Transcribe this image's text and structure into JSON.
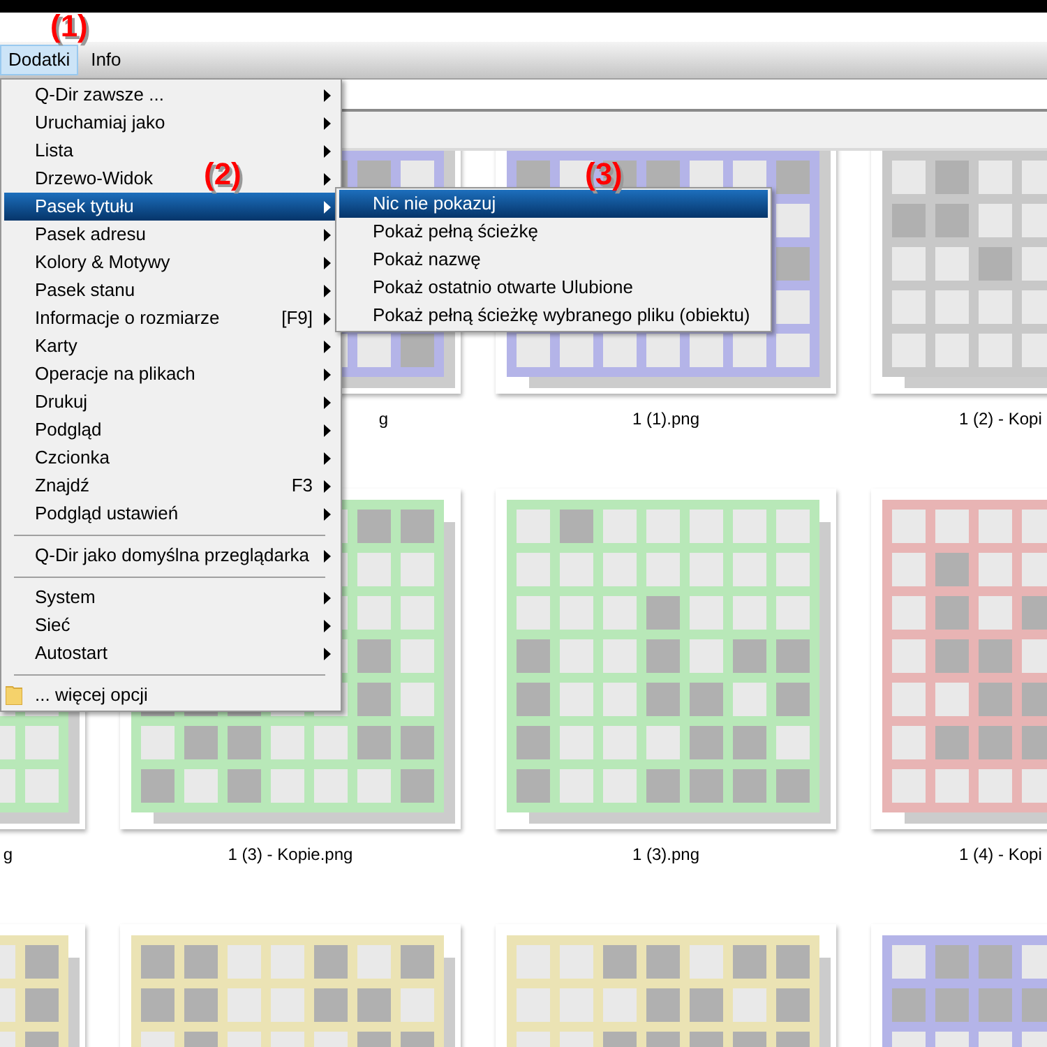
{
  "annotations": [
    {
      "label": "(1)"
    },
    {
      "label": "(2)"
    },
    {
      "label": "(3)"
    }
  ],
  "menu_bar": [
    {
      "label": "Dodatki",
      "selected": true
    },
    {
      "label": "Info",
      "selected": false
    }
  ],
  "menu": {
    "items": [
      {
        "kind": "item",
        "label": "Q-Dir zawsze ...",
        "selected": false
      },
      {
        "kind": "item",
        "label": "Uruchamiaj jako",
        "selected": false
      },
      {
        "kind": "item",
        "label": "Lista",
        "selected": false
      },
      {
        "kind": "item",
        "label": "Drzewo-Widok",
        "selected": false
      },
      {
        "kind": "item",
        "label": "Pasek tytułu",
        "selected": true
      },
      {
        "kind": "item",
        "label": "Pasek adresu",
        "selected": false
      },
      {
        "kind": "item",
        "label": "Kolory & Motywy",
        "selected": false
      },
      {
        "kind": "item",
        "label": "Pasek stanu",
        "selected": false
      },
      {
        "kind": "item",
        "label": "Informacje o rozmiarze",
        "shortcut": "[F9]",
        "selected": false
      },
      {
        "kind": "item",
        "label": "Karty",
        "selected": false
      },
      {
        "kind": "item",
        "label": "Operacje na plikach",
        "selected": false
      },
      {
        "kind": "item",
        "label": "Drukuj",
        "selected": false
      },
      {
        "kind": "item",
        "label": "Podgląd",
        "selected": false
      },
      {
        "kind": "item",
        "label": "Czcionka",
        "selected": false
      },
      {
        "kind": "item",
        "label": "Znajdź",
        "shortcut": "F3",
        "selected": false
      },
      {
        "kind": "item",
        "label": "Podgląd ustawień",
        "selected": false
      },
      {
        "kind": "separator"
      },
      {
        "kind": "item",
        "label": "Q-Dir jako domyślna przeglądarka",
        "selected": false
      },
      {
        "kind": "separator"
      },
      {
        "kind": "item",
        "label": "System",
        "selected": false
      },
      {
        "kind": "item",
        "label": "Sieć",
        "selected": false
      },
      {
        "kind": "item",
        "label": "Autostart",
        "selected": false
      },
      {
        "kind": "separator"
      },
      {
        "kind": "folder",
        "label": "... więcej opcji",
        "selected": false
      }
    ]
  },
  "submenu": {
    "items": [
      {
        "label": "Nic nie pokazuj",
        "selected": true
      },
      {
        "label": "Pokaż pełną ścieżkę",
        "selected": false
      },
      {
        "label": "Pokaż nazwę",
        "selected": false
      },
      {
        "label": "Pokaż ostatnio otwarte Ulubione",
        "selected": false
      },
      {
        "label": "Pokaż pełną ścieżkę wybranego pliku (obiektu)",
        "selected": false
      }
    ]
  },
  "files": [
    [
      {
        "kind": "cut_left",
        "color": "#b4b4e8",
        "label": "g"
      },
      {
        "kind": "tile",
        "color": "#b4b4e8",
        "label": "1 (1).png"
      },
      {
        "kind": "cut_right",
        "color": "#c8c8c8",
        "label": "1 (2) - Kopi"
      }
    ],
    [
      {
        "kind": "cut_left",
        "color": "#b8e8b8",
        "label": "g"
      },
      {
        "kind": "tile",
        "color": "#b8e8b8",
        "label": "1 (3) - Kopie.png"
      },
      {
        "kind": "tile",
        "color": "#b8e8b8",
        "label": "1 (3).png"
      },
      {
        "kind": "cut_right",
        "color": "#e8b4b4",
        "label": "1 (4) - Kopi"
      }
    ],
    [
      {
        "color": "#ebe3b4"
      },
      {
        "color": "#ebe3b4"
      },
      {
        "color": "#ebe3b4"
      },
      {
        "color": "#b4b4e8"
      }
    ]
  ]
}
